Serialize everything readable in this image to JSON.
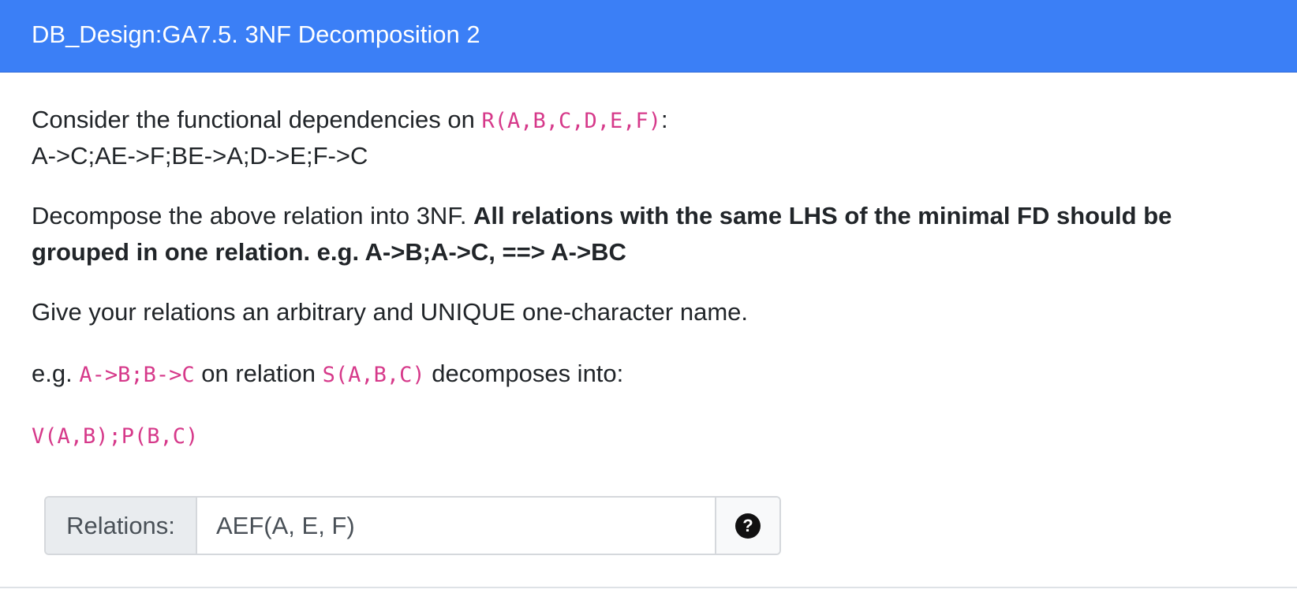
{
  "header": {
    "title": "DB_Design:GA7.5. 3NF Decomposition 2"
  },
  "question": {
    "p1_text": "Consider the functional dependencies on ",
    "p1_relation": "R(A,B,C,D,E,F)",
    "p1_colon": ":",
    "fds": "A->C;AE->F;BE->A;D->E;F->C",
    "p2_text": "Decompose the above relation into 3NF. ",
    "p2_bold_line1": "All relations with the same LHS of the minimal FD should be",
    "p2_bold_line2": "grouped in one relation. e.g. A->B;A->C, ==> A->BC",
    "p3_text": "Give your relations an arbitrary and UNIQUE one-character name.",
    "p4_prefix": "e.g. ",
    "p4_fds": "A->B;B->C",
    "p4_mid": " on relation ",
    "p4_relation": "S(A,B,C)",
    "p4_suffix": " decomposes into:",
    "example_answer": "V(A,B);P(B,C)"
  },
  "answer": {
    "label": "Relations:",
    "value": "AEF(A, E, F)",
    "help_icon": "question-circle-icon",
    "help_glyph": "?"
  },
  "colors": {
    "header_bg": "#3b7ff6",
    "code_text": "#d6398a"
  }
}
